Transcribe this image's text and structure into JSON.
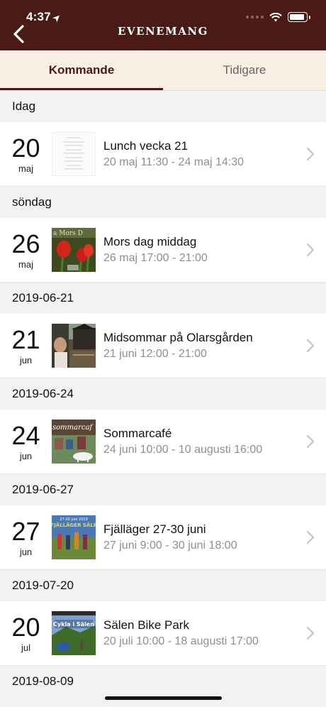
{
  "status": {
    "time": "4:37"
  },
  "nav": {
    "title": "EVENEMANG"
  },
  "tabs": [
    {
      "label": "Kommande"
    },
    {
      "label": "Tidigare"
    }
  ],
  "colors": {
    "brand": "#4a1a14",
    "tab_bg": "#f7efe4",
    "muted": "#8e8e93"
  },
  "sections": [
    {
      "header": "Idag",
      "event": {
        "day": "20",
        "month": "maj",
        "title": "Lunch vecka 21",
        "time": "20 maj 11:30 - 24 maj 14:30"
      }
    },
    {
      "header": "söndag",
      "event": {
        "day": "26",
        "month": "maj",
        "title": "Mors dag middag",
        "time": "26 maj 17:00 - 21:00"
      }
    },
    {
      "header": "2019-06-21",
      "event": {
        "day": "21",
        "month": "jun",
        "title": "Midsommar på Olarsgården",
        "time": "21 juni 12:00 - 21:00"
      }
    },
    {
      "header": "2019-06-24",
      "event": {
        "day": "24",
        "month": "jun",
        "title": "Sommarcafé",
        "time": "24 juni 10:00 - 10 augusti 16:00"
      }
    },
    {
      "header": "2019-06-27",
      "event": {
        "day": "27",
        "month": "jun",
        "title": "Fjälläger 27-30 juni",
        "time": "27 juni 9:00 - 30 juni 18:00"
      }
    },
    {
      "header": "2019-07-20",
      "event": {
        "day": "20",
        "month": "jul",
        "title": "Sälen Bike Park",
        "time": "20 juli 10:00 - 18 augusti 17:00"
      }
    },
    {
      "header": "2019-08-09"
    }
  ],
  "thumb_text": {
    "mors": "a Mors D",
    "sommar": "sommarcaf",
    "fjall": "FJÄLLÄGER SÄLE",
    "fjall_top": "27-30 juni 2019",
    "bike": "Cykla i Sälen"
  }
}
